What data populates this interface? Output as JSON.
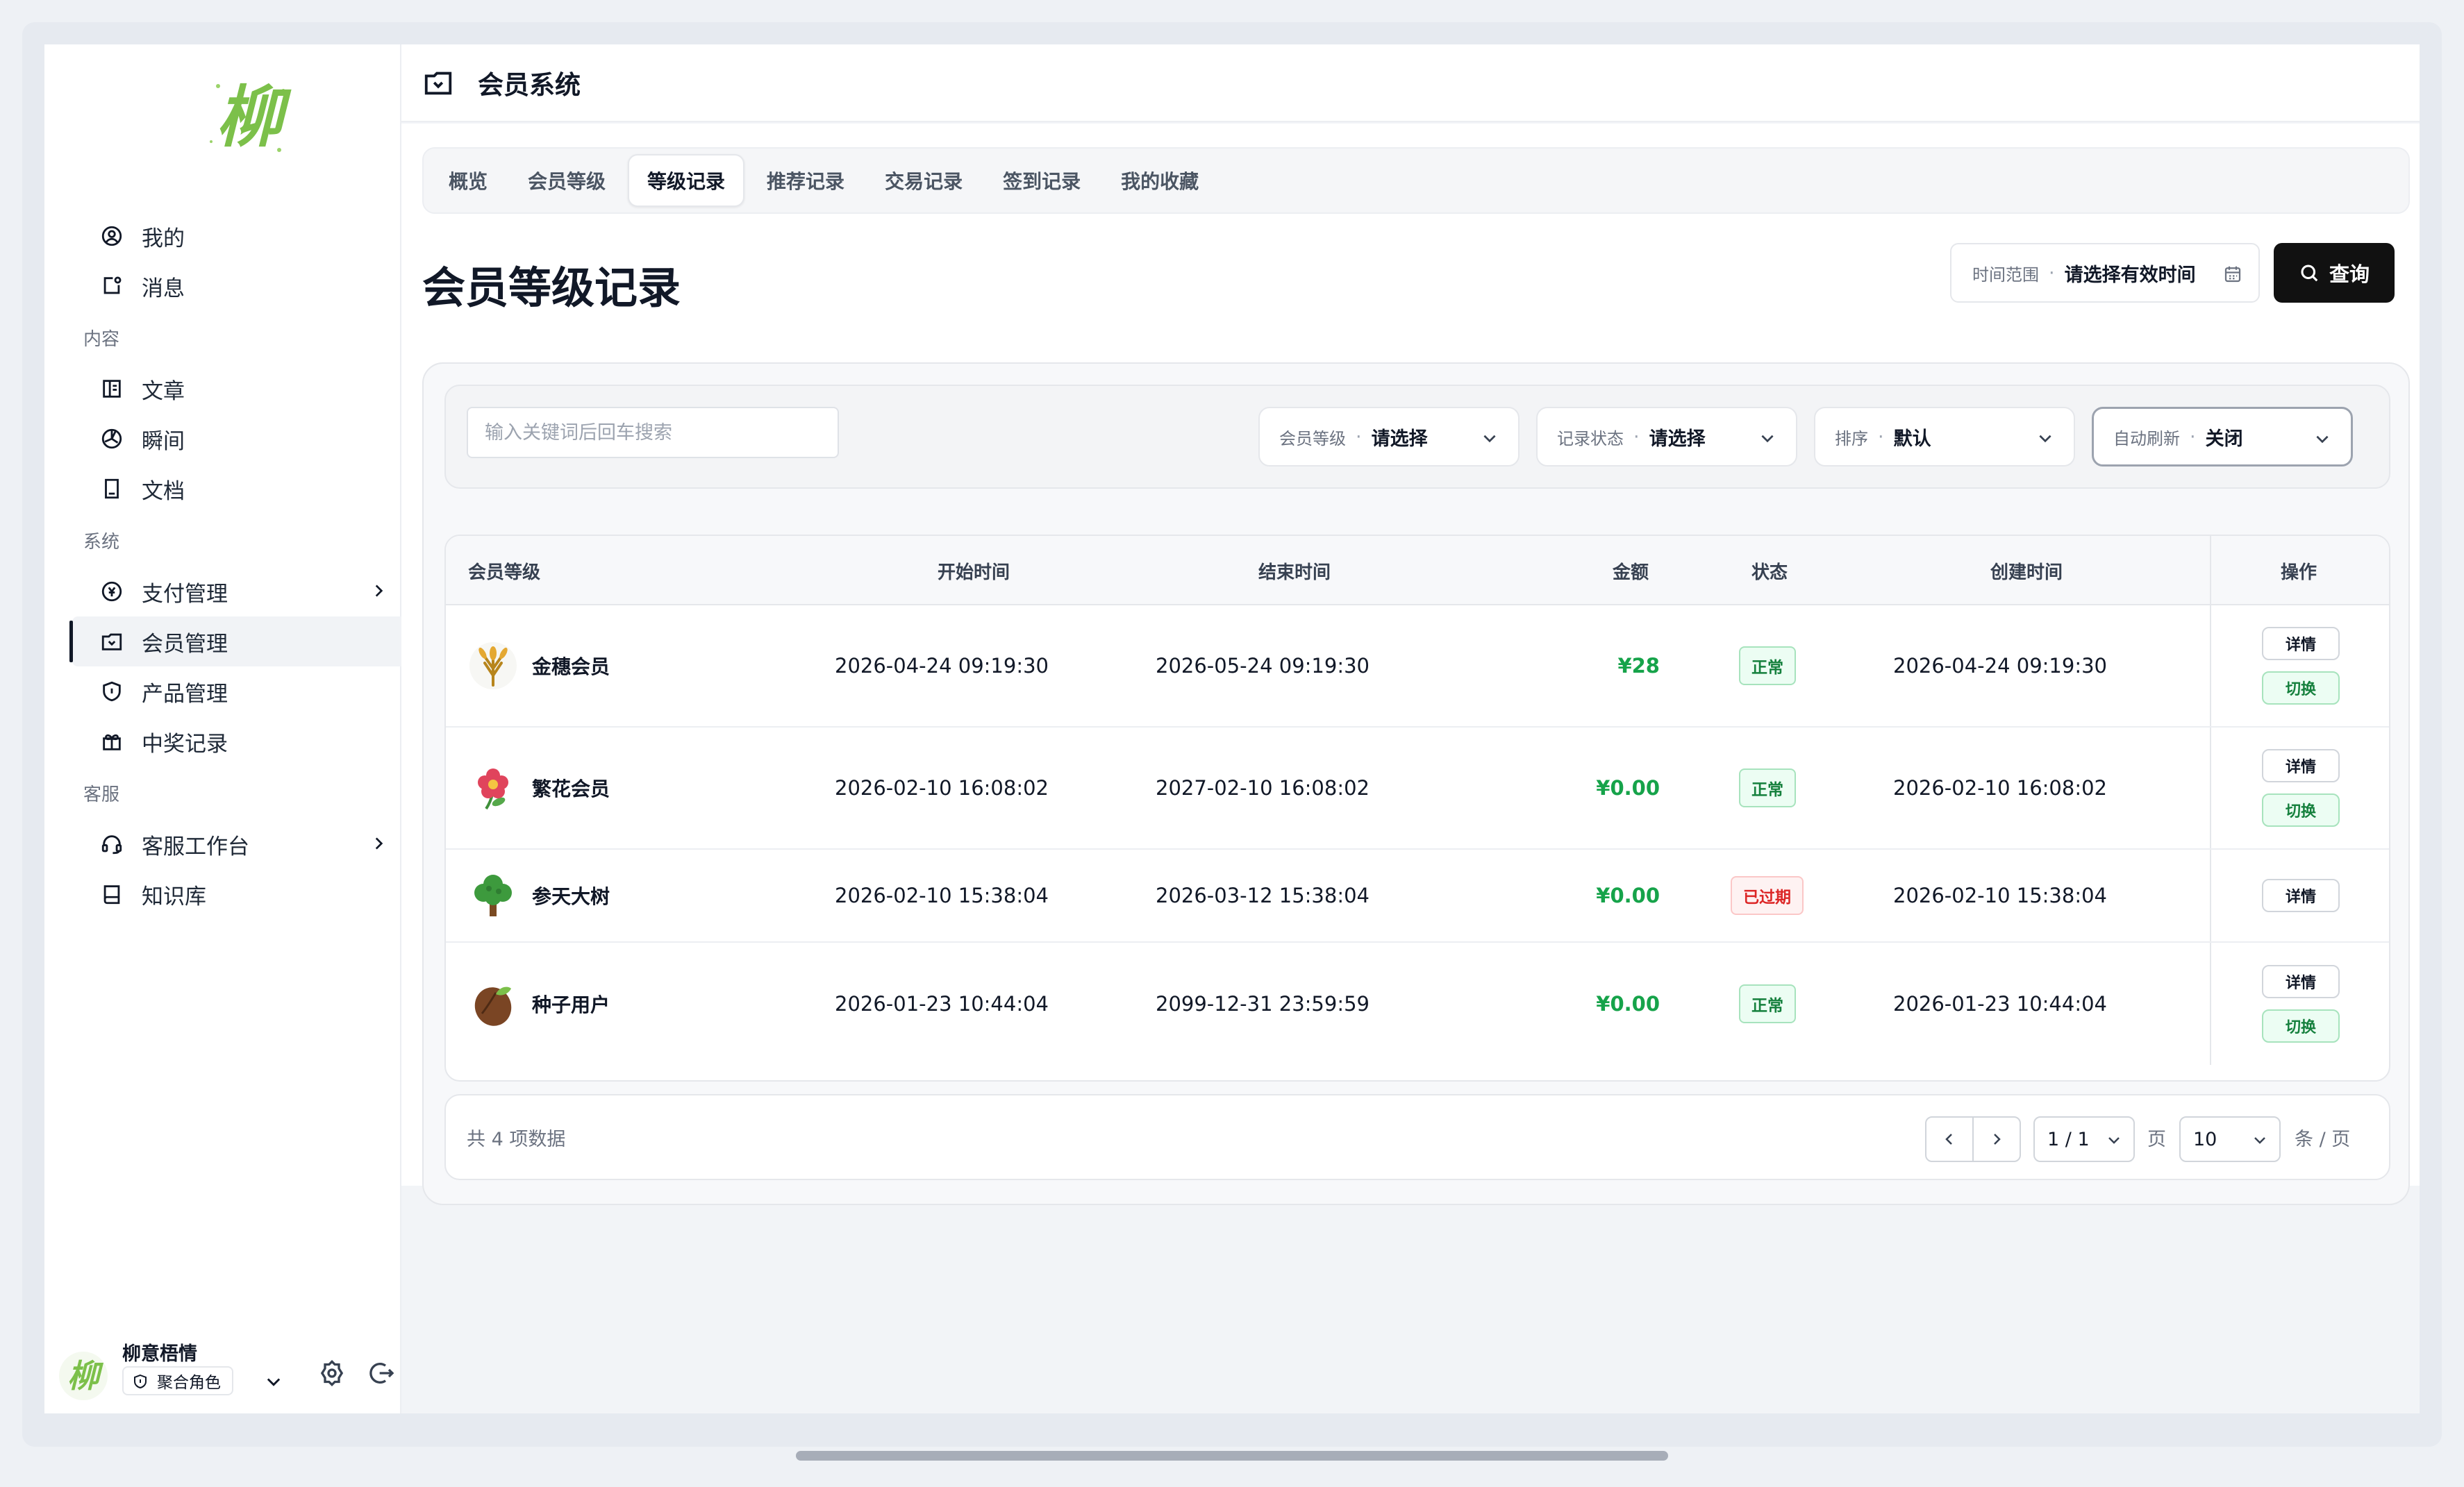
{
  "app": {
    "logo_text": "柳",
    "user": {
      "name": "柳意梧情",
      "role": "聚合角色"
    }
  },
  "sidebar": {
    "top_items": [
      {
        "label": "我的",
        "icon": "user-circle-icon"
      },
      {
        "label": "消息",
        "icon": "message-icon"
      }
    ],
    "sections": [
      {
        "title": "内容",
        "items": [
          {
            "label": "文章",
            "icon": "article-icon"
          },
          {
            "label": "瞬间",
            "icon": "moment-icon"
          },
          {
            "label": "文档",
            "icon": "document-icon"
          }
        ]
      },
      {
        "title": "系统",
        "items": [
          {
            "label": "支付管理",
            "icon": "payment-icon",
            "has_children": true
          },
          {
            "label": "会员管理",
            "icon": "member-icon",
            "active": true
          },
          {
            "label": "产品管理",
            "icon": "product-icon"
          },
          {
            "label": "中奖记录",
            "icon": "gift-icon"
          }
        ]
      },
      {
        "title": "客服",
        "items": [
          {
            "label": "客服工作台",
            "icon": "headset-icon",
            "has_children": true
          },
          {
            "label": "知识库",
            "icon": "book-icon"
          }
        ]
      }
    ]
  },
  "header": {
    "title": "会员系统"
  },
  "tabs": [
    "概览",
    "会员等级",
    "等级记录",
    "推荐记录",
    "交易记录",
    "签到记录",
    "我的收藏"
  ],
  "active_tab": "等级记录",
  "page": {
    "title": "会员等级记录",
    "time_range": {
      "label": "时间范围",
      "value": "请选择有效时间"
    },
    "query_label": "查询"
  },
  "filters": {
    "search_placeholder": "输入关键词后回车搜索",
    "level": {
      "label": "会员等级",
      "value": "请选择"
    },
    "status": {
      "label": "记录状态",
      "value": "请选择"
    },
    "sort": {
      "label": "排序",
      "value": "默认"
    },
    "refresh": {
      "label": "自动刷新",
      "value": "关闭"
    }
  },
  "table": {
    "columns": {
      "level": "会员等级",
      "start": "开始时间",
      "end": "结束时间",
      "amount": "金额",
      "status": "状态",
      "created": "创建时间",
      "ops": "操作"
    },
    "detail_label": "详情",
    "switch_label": "切换",
    "rows": [
      {
        "level": "金穗会员",
        "icon": "wheat-icon",
        "start": "2026-04-24 09:19:30",
        "end": "2026-05-24 09:19:30",
        "amount": "¥28",
        "status": "正常",
        "status_type": "ok",
        "created": "2026-04-24 09:19:30",
        "switchable": true
      },
      {
        "level": "繁花会员",
        "icon": "flower-icon",
        "start": "2026-02-10 16:08:02",
        "end": "2027-02-10 16:08:02",
        "amount": "¥0.00",
        "status": "正常",
        "status_type": "ok",
        "created": "2026-02-10 16:08:02",
        "switchable": true
      },
      {
        "level": "参天大树",
        "icon": "tree-icon",
        "start": "2026-02-10 15:38:04",
        "end": "2026-03-12 15:38:04",
        "amount": "¥0.00",
        "status": "已过期",
        "status_type": "exp",
        "created": "2026-02-10 15:38:04",
        "switchable": false
      },
      {
        "level": "种子用户",
        "icon": "seed-icon",
        "start": "2026-01-23 10:44:04",
        "end": "2099-12-31 23:59:59",
        "amount": "¥0.00",
        "status": "正常",
        "status_type": "ok",
        "created": "2026-01-23 10:44:04",
        "switchable": true
      }
    ]
  },
  "pagination": {
    "total_text": "共 4 项数据",
    "page_value": "1 / 1",
    "page_unit": "页",
    "size_value": "10",
    "size_unit": "条 / 页"
  },
  "colors": {
    "accent": "#111111",
    "success": "#16a34a",
    "danger": "#dc2626",
    "logo": "#7cc04a"
  }
}
